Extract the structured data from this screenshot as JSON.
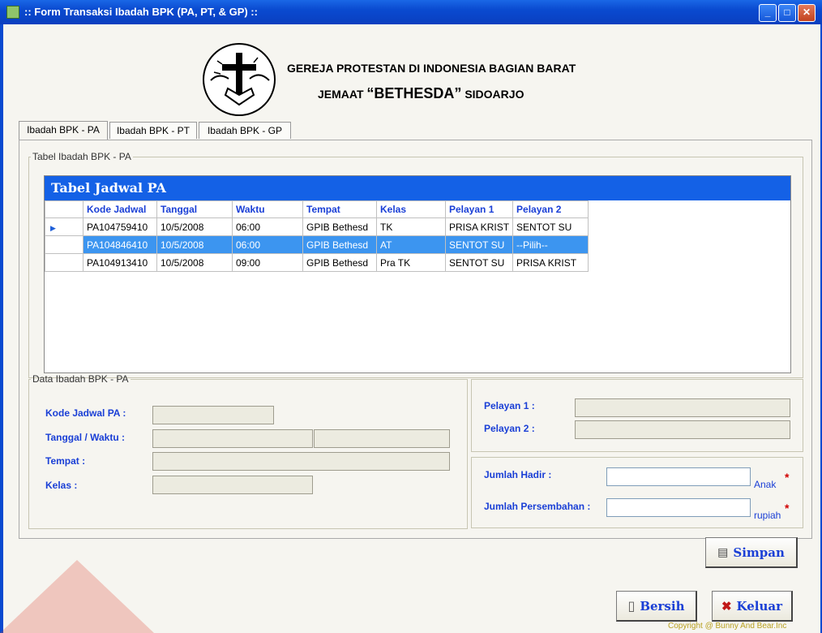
{
  "window": {
    "title": ":: Form Transaksi Ibadah BPK (PA, PT, & GP) ::"
  },
  "header": {
    "church_line1": "GEREJA PROTESTAN DI INDONESIA BAGIAN BARAT",
    "church_line2_prefix": "JEMAAT",
    "church_line2_name": "“BETHESDA”",
    "church_line2_suffix": "SIDOARJO"
  },
  "tabs": [
    "Ibadah BPK - PA",
    "Ibadah BPK - PT",
    "Ibadah BPK - GP"
  ],
  "table_group": {
    "legend": "Tabel Ibadah BPK - PA"
  },
  "grid": {
    "caption": "Tabel Jadwal PA",
    "columns": [
      "Kode Jadwal",
      "Tanggal",
      "Waktu",
      "Tempat",
      "Kelas",
      "Pelayan 1",
      "Pelayan 2"
    ],
    "rows": [
      [
        "PA104759410",
        "10/5/2008",
        "06:00",
        "GPIB Bethesd",
        "TK",
        "PRISA KRIST",
        "SENTOT SU"
      ],
      [
        "PA104846410",
        "10/5/2008",
        "06:00",
        "GPIB Bethesd",
        "AT",
        "SENTOT SU",
        "--Pilih--"
      ],
      [
        "PA104913410",
        "10/5/2008",
        "09:00",
        "GPIB Bethesd",
        "Pra TK",
        "SENTOT SU",
        "PRISA KRIST"
      ]
    ],
    "selected_row": 1,
    "current_row_marker_row": 0
  },
  "data_group": {
    "legend": "Data Ibadah BPK - PA",
    "kode_label": "Kode Jadwal PA :",
    "tanggal_label": "Tanggal / Waktu :",
    "tempat_label": "Tempat :",
    "kelas_label": "Kelas :",
    "pelayan1_label": "Pelayan 1 :",
    "pelayan2_label": "Pelayan 2 :",
    "jumlah_hadir_label": "Jumlah Hadir :",
    "jumlah_hadir_unit": "Anak",
    "jumlah_persembahan_label": "Jumlah Persembahan :",
    "jumlah_persembahan_unit": "rupiah",
    "required_mark": "*"
  },
  "buttons": {
    "simpan": "Simpan",
    "bersih": "Bersih",
    "keluar": "Keluar"
  },
  "footer": {
    "copyright": "Copyright @ Bunny And Bear.Inc"
  },
  "colors": {
    "titlebar": "#0a4ad0",
    "grid_caption": "#1461e6",
    "selected_row": "#3c95f0",
    "label_blue": "#1a3fd6",
    "required": "#d00000"
  }
}
